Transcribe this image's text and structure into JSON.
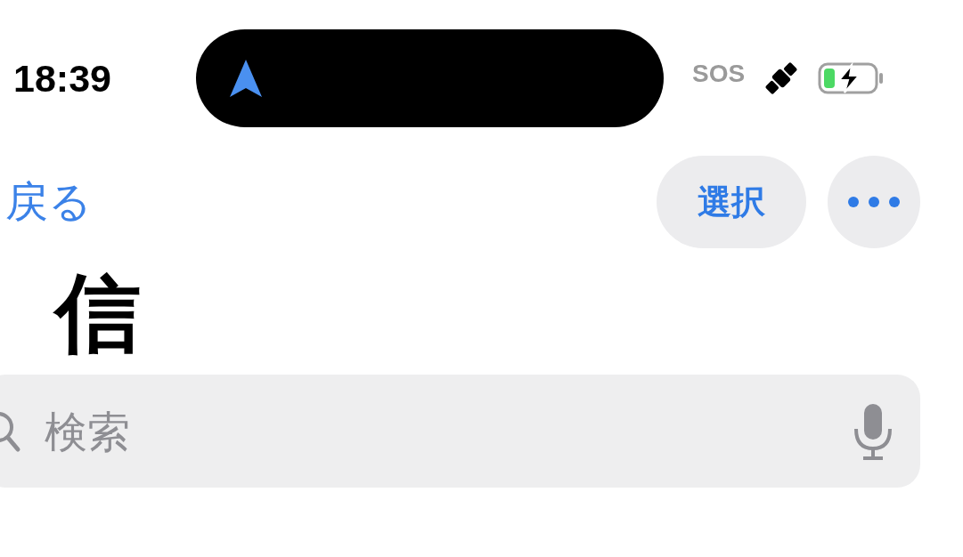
{
  "status_bar": {
    "time": "18:39",
    "sos": "SOS"
  },
  "nav": {
    "back": "戻る",
    "select": "選択"
  },
  "title": "信",
  "search": {
    "placeholder": "検索"
  }
}
